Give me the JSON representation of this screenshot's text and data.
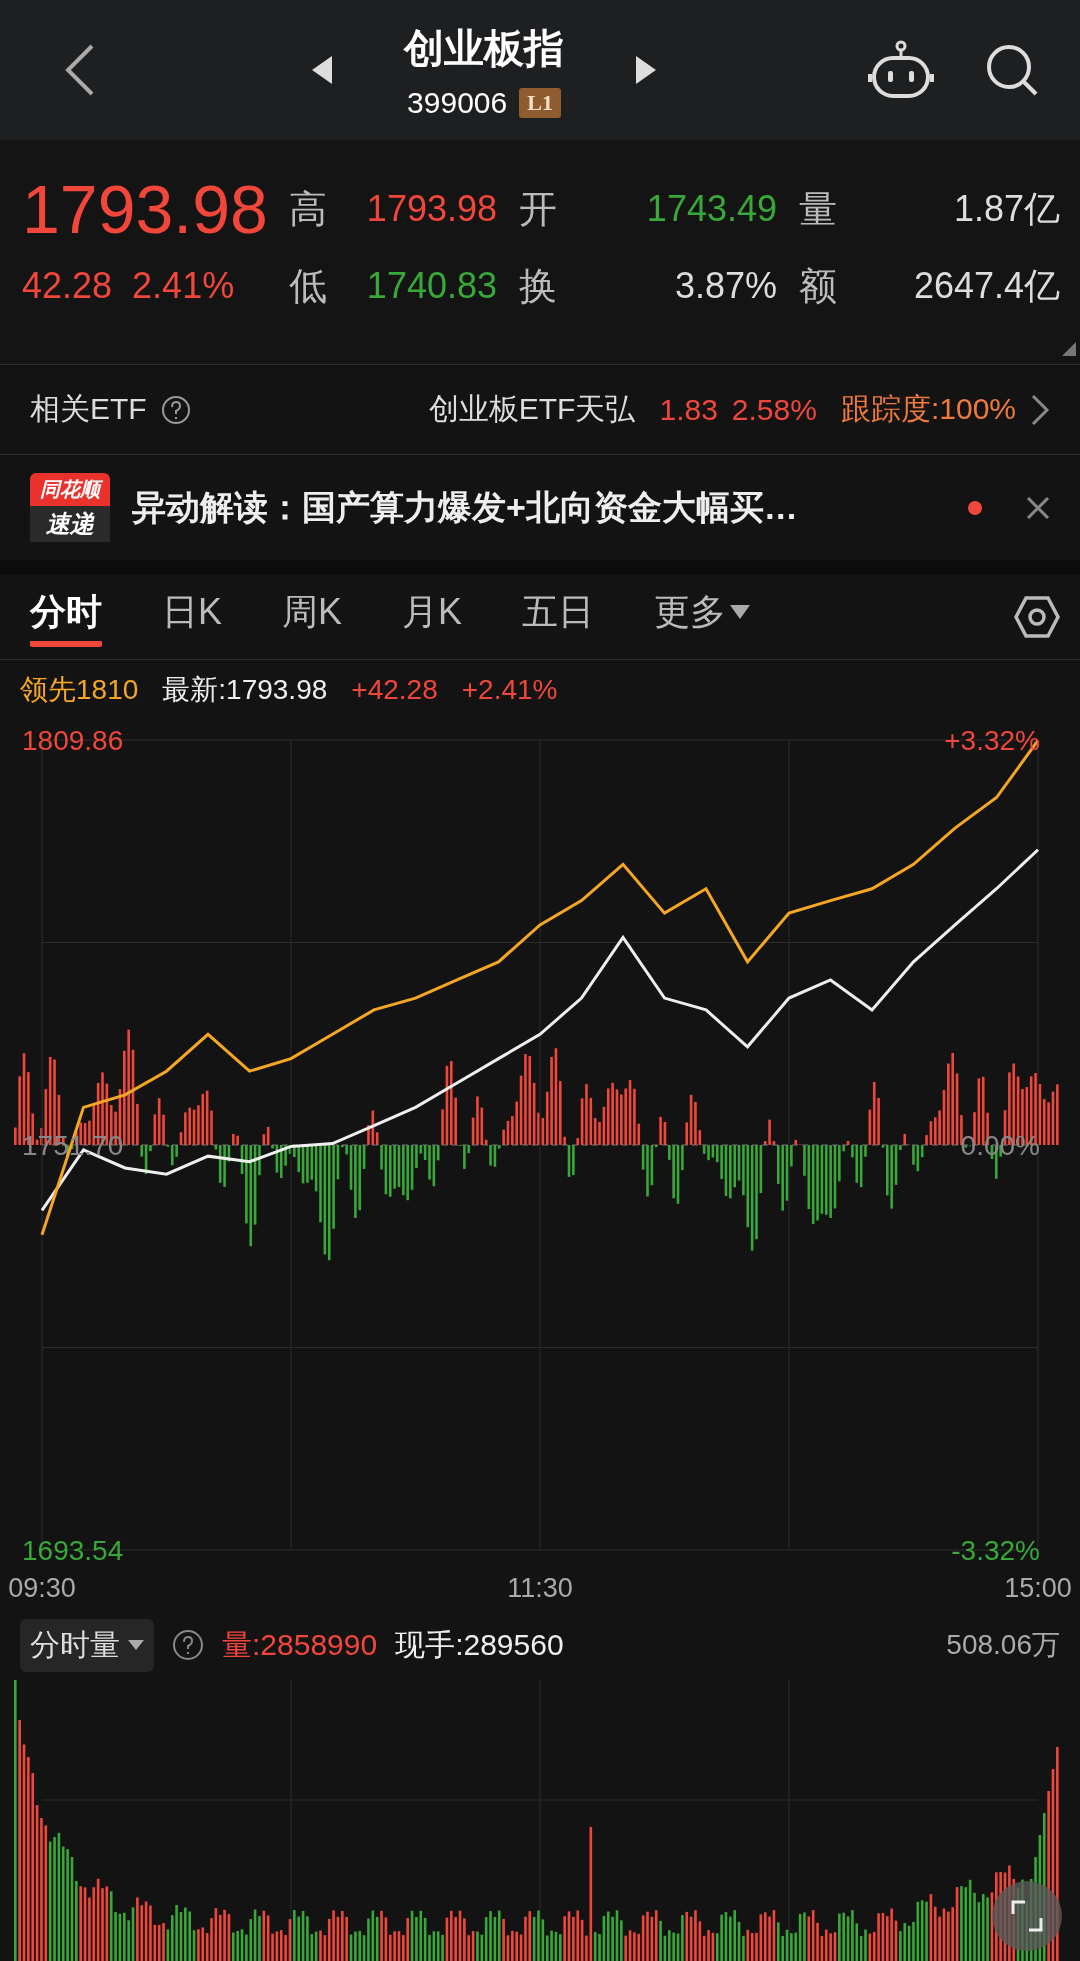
{
  "header": {
    "title": "创业板指",
    "code": "399006",
    "badge": "L1"
  },
  "quote": {
    "price": "1793.98",
    "change": "42.28",
    "change_pct": "2.41%",
    "color": "#f0473a",
    "stats": [
      {
        "label": "高",
        "value": "1793.98",
        "color": "#f0473a"
      },
      {
        "label": "开",
        "value": "1743.49",
        "color": "#38a838"
      },
      {
        "label": "量",
        "value": "1.87亿",
        "color": "#dddddd"
      },
      {
        "label": "低",
        "value": "1740.83",
        "color": "#38a838"
      },
      {
        "label": "换",
        "value": "3.87%",
        "color": "#dddddd"
      },
      {
        "label": "额",
        "value": "2647.4亿",
        "color": "#dddddd"
      }
    ]
  },
  "etf": {
    "label": "相关ETF",
    "name": "创业板ETF天弘",
    "price": "1.83",
    "pct": "2.58%",
    "tracking": "跟踪度:100%"
  },
  "news": {
    "logo_top": "同花顺",
    "logo_bottom": "速递",
    "text": "异动解读：国产算力爆发+北向资金大幅买…",
    "unread": true
  },
  "tabs": [
    {
      "label": "分时",
      "selected": true,
      "kind": "tab"
    },
    {
      "label": "日K",
      "selected": false,
      "kind": "tab"
    },
    {
      "label": "周K",
      "selected": false,
      "kind": "tab"
    },
    {
      "label": "月K",
      "selected": false,
      "kind": "tab"
    },
    {
      "label": "五日",
      "selected": false,
      "kind": "tab"
    },
    {
      "label": "更多",
      "selected": false,
      "kind": "dropdown"
    }
  ],
  "legend": {
    "change": "+42.28",
    "pct": "+2.41%"
  },
  "chart": {
    "right_labels": [
      "+3.32%",
      "0.00%",
      "-3.32%"
    ],
    "chart_data": {
      "type": "line",
      "categories": [
        "09:30",
        null,
        null,
        null,
        null,
        null,
        null,
        null,
        null,
        null,
        null,
        null,
        "11:30",
        null,
        null,
        null,
        null,
        null,
        null,
        null,
        null,
        null,
        null,
        null,
        "15:00"
      ],
      "series": [
        {
          "name": "最新:1793.98",
          "color": "#eeeeee",
          "values": [
            1742.3,
            1751.0,
            1748.4,
            1747.5,
            1750.1,
            1749.3,
            1751.5,
            1751.9,
            1754.5,
            1757.1,
            1760.6,
            1764.1,
            1767.6,
            1772.8,
            1781.5,
            1772.8,
            1771.1,
            1765.8,
            1772.8,
            1775.4,
            1771.1,
            1778.0,
            1783.3,
            1788.5,
            1794.1
          ]
        },
        {
          "name": "领先1810",
          "color": "#f5a623",
          "values": [
            1738.8,
            1757.1,
            1758.9,
            1762.3,
            1767.6,
            1762.3,
            1764.1,
            1767.6,
            1771.1,
            1772.8,
            1775.4,
            1778.0,
            1783.3,
            1786.8,
            1792.0,
            1785.0,
            1788.5,
            1778.0,
            1785.0,
            1786.8,
            1788.5,
            1792.0,
            1797.2,
            1801.6,
            1809.8
          ]
        }
      ],
      "ylim": [
        1693.54,
        1809.86
      ],
      "grid": true,
      "ref_lines": [
        {
          "axis": "y",
          "value": 1751.7
        }
      ],
      "yticks": [
        {
          "value": 1809.86,
          "label": "1809.86"
        },
        {
          "value": 1751.7,
          "label": "1751.70"
        },
        {
          "value": 1693.54,
          "label": "1693.54"
        }
      ]
    }
  },
  "volume": {
    "selector": "分时量",
    "amount": "量:2858990",
    "current": "现手:289560",
    "max": "508.06万"
  }
}
